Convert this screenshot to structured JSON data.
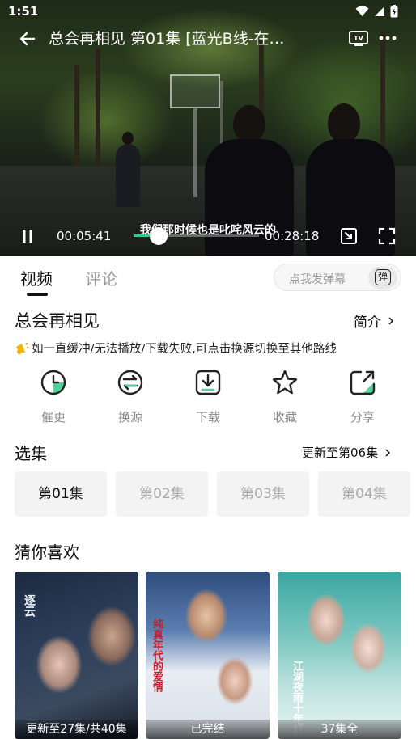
{
  "status_bar": {
    "time": "1:51"
  },
  "player": {
    "title": "总会再相见 第01集 [蓝光B线-在…",
    "subtitle": "我们那时候也是叱咤风云的",
    "current_time": "00:05:41",
    "total_time": "00:28:18",
    "progress_percent": 20
  },
  "tabs": [
    {
      "label": "视频"
    },
    {
      "label": "评论"
    }
  ],
  "danmu": {
    "placeholder": "点我发弹幕",
    "button": "弹"
  },
  "show": {
    "title": "总会再相见",
    "intro_label": "简介",
    "notice": "如一直缓冲/无法播放/下载失败,可点击换源切换至其他路线"
  },
  "actions": [
    {
      "label": "催更",
      "icon": "clock-icon"
    },
    {
      "label": "换源",
      "icon": "switch-source-icon"
    },
    {
      "label": "下载",
      "icon": "download-icon"
    },
    {
      "label": "收藏",
      "icon": "star-icon"
    },
    {
      "label": "分享",
      "icon": "share-icon"
    }
  ],
  "episodes": {
    "title": "选集",
    "update_text": "更新至第06集",
    "items": [
      "第01集",
      "第02集",
      "第03集",
      "第04集"
    ]
  },
  "recommendations": {
    "title": "猜你喜欢",
    "items": [
      {
        "caption": "更新至27集/共40集",
        "poster_text": "逐云"
      },
      {
        "caption": "已完结",
        "poster_text": "纯真年代的爱情"
      },
      {
        "caption": "37集全",
        "poster_text": "江湖夜雨十年灯"
      }
    ]
  },
  "colors": {
    "accent": "#38c98a",
    "muted": "#999999"
  }
}
